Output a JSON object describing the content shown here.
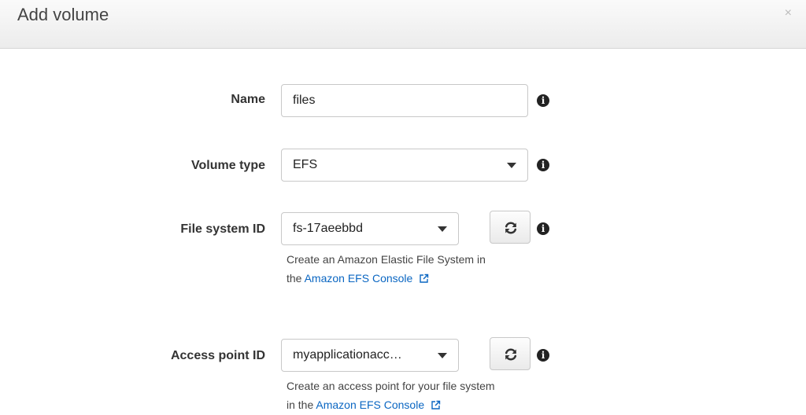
{
  "dialog": {
    "title": "Add volume",
    "close_glyph": "×"
  },
  "form": {
    "name": {
      "label": "Name",
      "value": "files"
    },
    "volume_type": {
      "label": "Volume type",
      "value": "EFS"
    },
    "file_system_id": {
      "label": "File system ID",
      "value": "fs-17aeebbd",
      "help_text": "Create an Amazon Elastic File System in",
      "help_prefix": "the",
      "help_link": "Amazon EFS Console"
    },
    "access_point_id": {
      "label": "Access point ID",
      "value": "myapplicationacc…",
      "help_text": "Create an access point for your file system",
      "help_prefix": "in the",
      "help_link": "Amazon EFS Console"
    }
  },
  "icons": {
    "info": "info-icon",
    "refresh": "refresh-icon",
    "dropdown": "chevron-down-icon",
    "external": "external-link-icon"
  },
  "colors": {
    "link": "#0a66c2",
    "label": "#333333"
  }
}
